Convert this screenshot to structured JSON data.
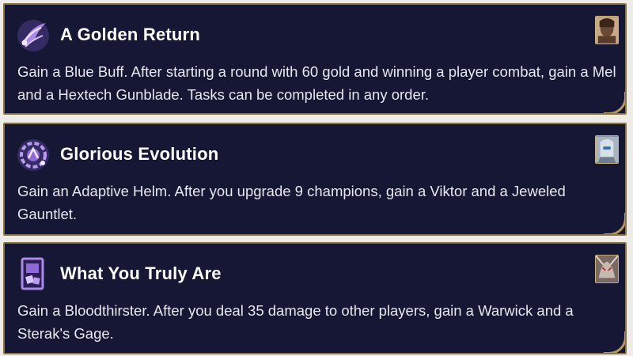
{
  "augments": [
    {
      "title": "A Golden Return",
      "description": "Gain a Blue Buff. After starting a round with 60 gold and winning a player combat, gain a Mel and a Hextech Gunblade. Tasks can be completed in any order.",
      "icon": "wings-gold-icon",
      "portrait": "champion-portrait-mel"
    },
    {
      "title": "Glorious Evolution",
      "description": "Gain an Adaptive Helm. After you upgrade 9 champions, gain a Viktor and a Jeweled Gauntlet.",
      "icon": "evolution-gear-icon",
      "portrait": "champion-portrait-viktor"
    },
    {
      "title": "What You Truly Are",
      "description": "Gain a Bloodthirster. After you deal 35 damage to other players, gain a Warwick and a Sterak's Gage.",
      "icon": "card-hand-icon",
      "portrait": "champion-portrait-warwick"
    }
  ],
  "colors": {
    "card_bg": "#161734",
    "border": "#8a7442",
    "icon_purple": "#8e6ad9",
    "title": "#ffffff",
    "text": "#e7e7ef"
  }
}
